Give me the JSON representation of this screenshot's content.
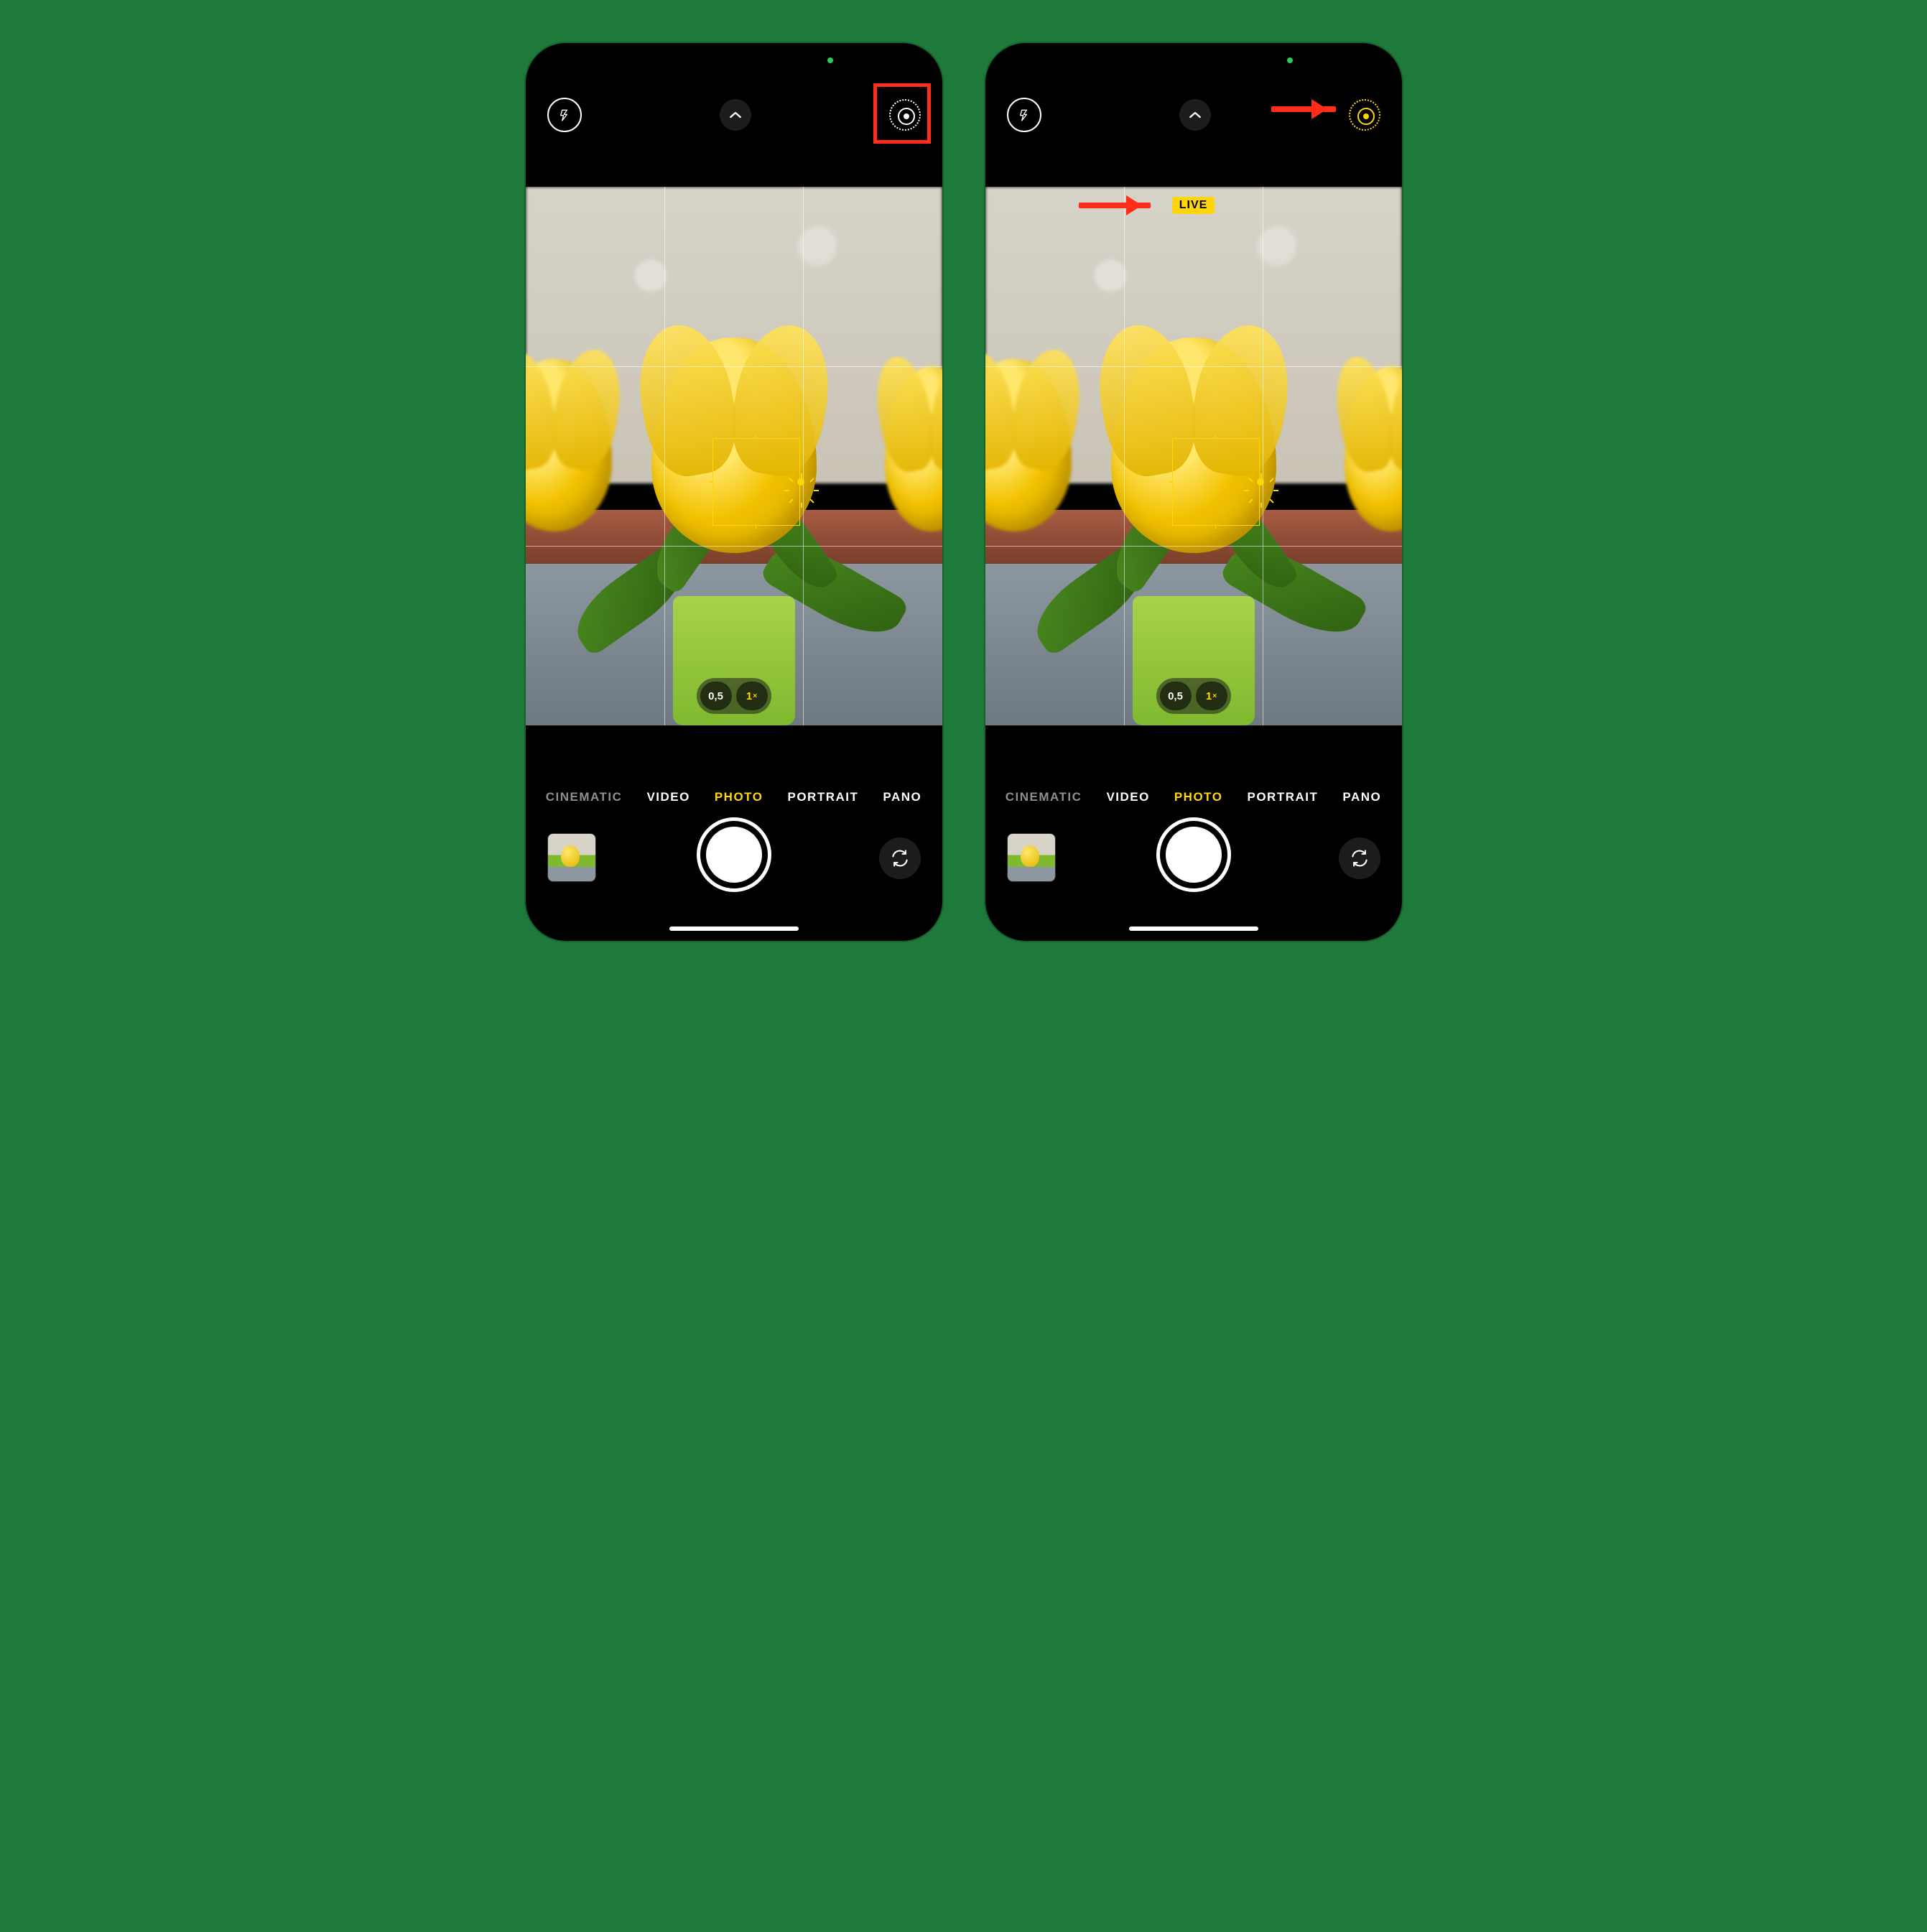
{
  "left": {
    "live_on": false,
    "live_badge": null,
    "zoom": {
      "options": [
        "0,5",
        "1"
      ],
      "selected": "1"
    },
    "modes": {
      "items": [
        "CINEMATIC",
        "VIDEO",
        "PHOTO",
        "PORTRAIT",
        "PANO"
      ],
      "selected": "PHOTO",
      "dimmed": [
        "CINEMATIC"
      ]
    },
    "annotation": {
      "type": "red-box",
      "target": "live-photo-button"
    }
  },
  "right": {
    "live_on": true,
    "live_badge": "LIVE",
    "zoom": {
      "options": [
        "0,5",
        "1"
      ],
      "selected": "1"
    },
    "modes": {
      "items": [
        "CINEMATIC",
        "VIDEO",
        "PHOTO",
        "PORTRAIT",
        "PANO"
      ],
      "selected": "PHOTO",
      "dimmed": [
        "CINEMATIC"
      ]
    },
    "annotation": {
      "type": "red-arrows",
      "targets": [
        "live-photo-button",
        "live-badge"
      ]
    }
  },
  "icons": {
    "flash": "flash-icon",
    "chevron": "chevron-up-icon",
    "live": "live-photo-icon",
    "switch": "camera-switch-icon",
    "sun": "exposure-sun-icon"
  },
  "colors": {
    "accent": "#ffd60a",
    "annotation": "#ff2d1a",
    "privacy_dot": "#34c759"
  }
}
